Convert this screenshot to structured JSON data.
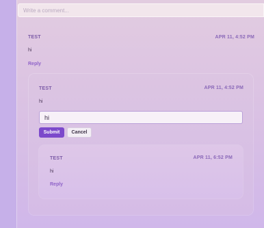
{
  "comment_box": {
    "placeholder": "Write a comment..."
  },
  "thread": {
    "root": {
      "author": "TEST",
      "date": "APR 11, 4:52 PM",
      "body": "hi",
      "reply_label": "Reply",
      "replies": [
        {
          "author": "TEST",
          "date": "APR 11, 4:52 PM",
          "body": "hi",
          "reply_form": {
            "value": "hi",
            "submit_label": "Submit",
            "cancel_label": "Cancel"
          },
          "replies": [
            {
              "author": "TEST",
              "date": "APR 11, 6:52 PM",
              "body": "hi",
              "reply_label": "Reply"
            }
          ]
        }
      ]
    }
  }
}
